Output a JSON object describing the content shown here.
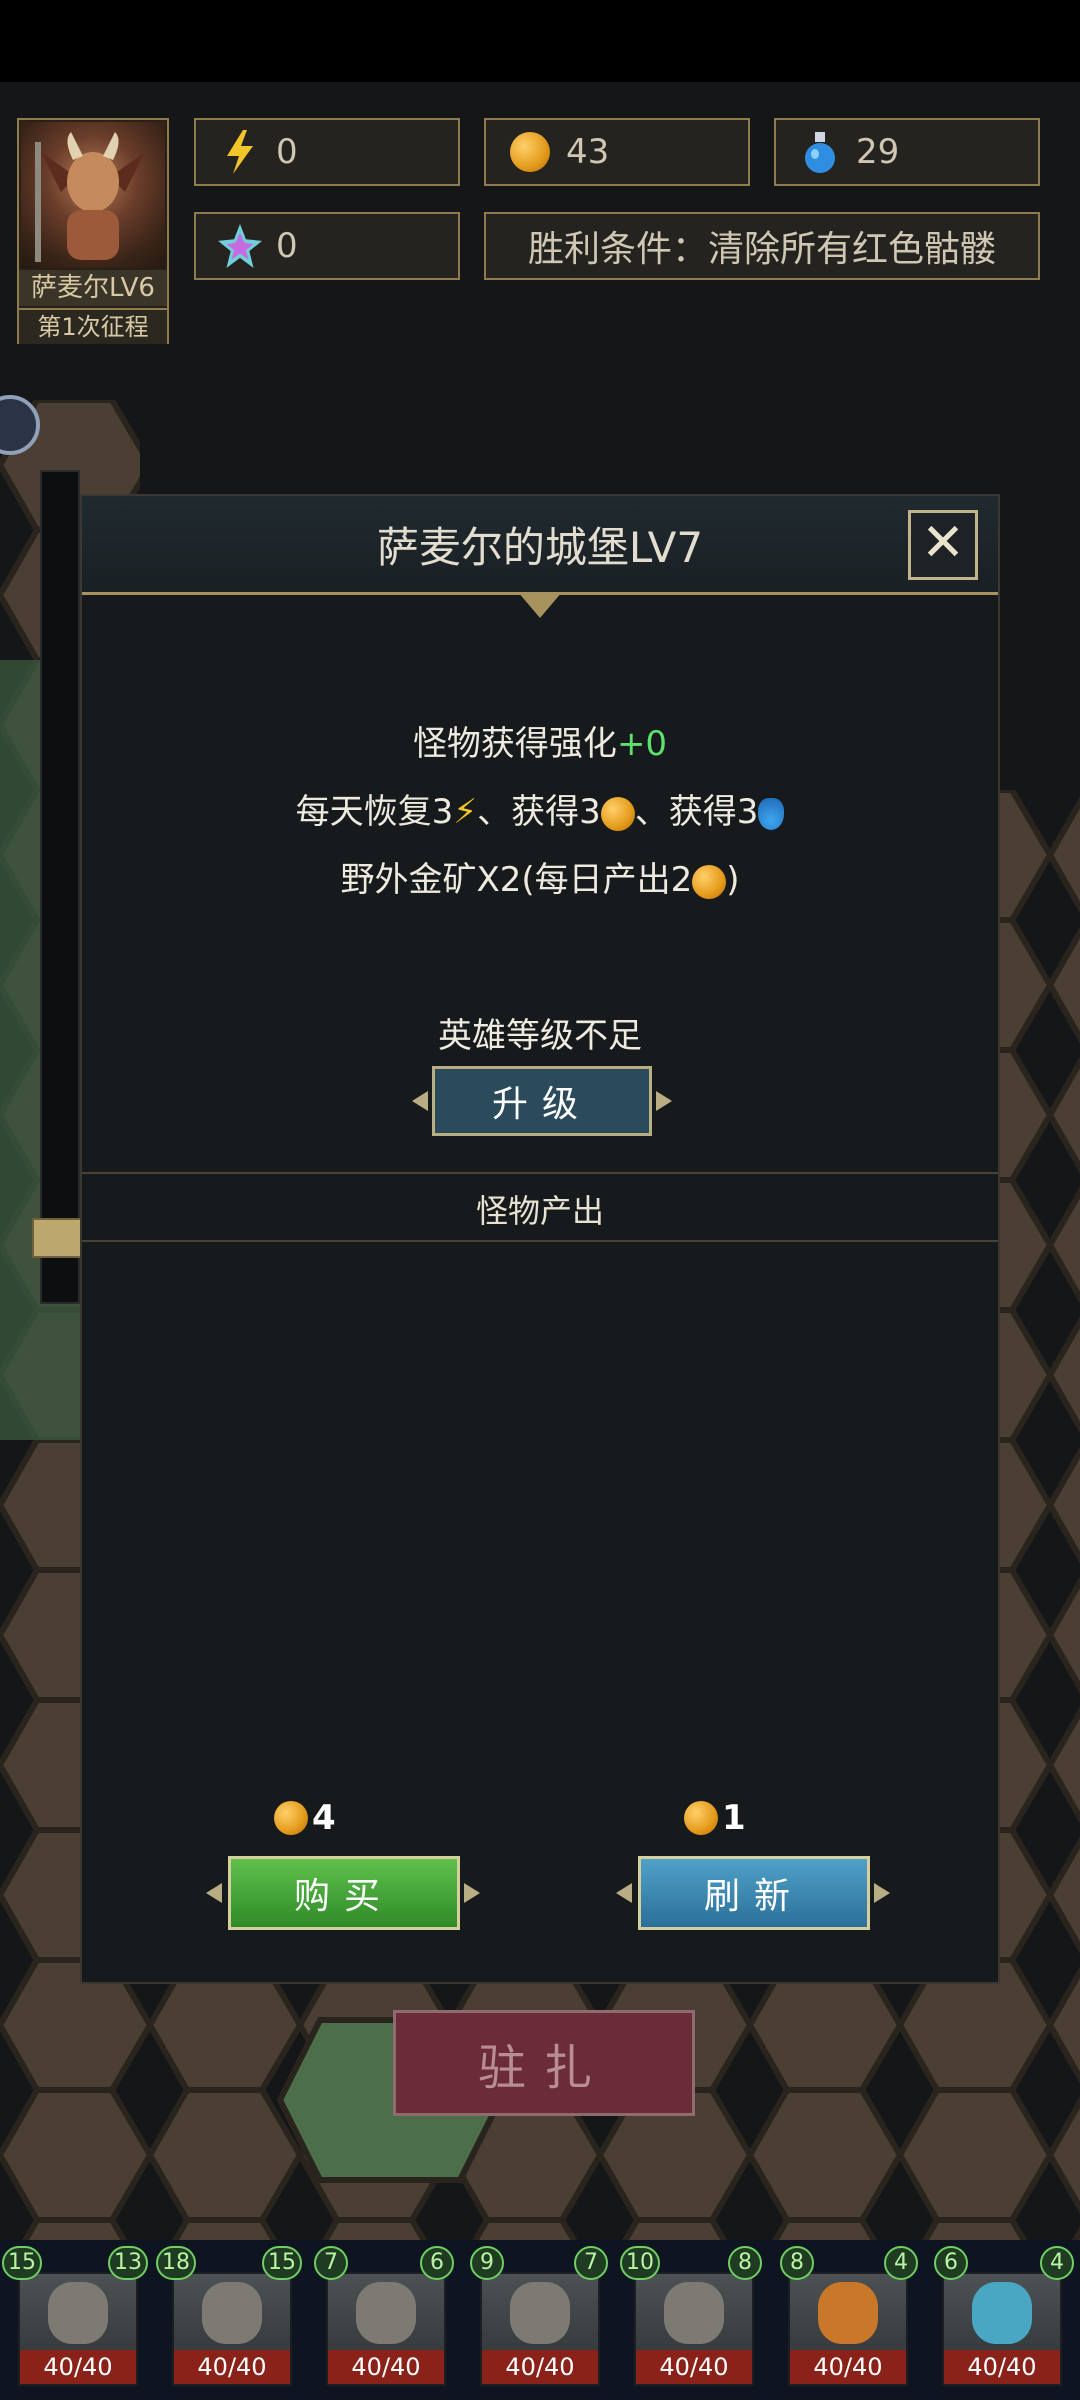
{
  "hero": {
    "name": "萨麦尔LV6",
    "expedition": "第1次征程"
  },
  "resources": {
    "energy": "0",
    "gold": "43",
    "potion": "29",
    "gems": "0"
  },
  "victory_condition": "胜利条件：清除所有红色骷髅",
  "castle": {
    "title": "萨麦尔的城堡LV7",
    "close_label": "✕",
    "buff_prefix": "怪物获得强化",
    "buff_value": "+0",
    "daily_a": "每天恢复3",
    "daily_b": "、获得3",
    "daily_c": "、获得3",
    "mine_a": "野外金矿X2(每日产出2",
    "mine_b": ")",
    "status": "英雄等级不足",
    "upgrade_label": "升级",
    "section_label": "怪物产出",
    "buy_cost": "4",
    "buy_label": "购买",
    "refresh_cost": "1",
    "refresh_label": "刷新"
  },
  "station_label": "驻扎",
  "units": [
    {
      "hp": "40/40",
      "left_level": "15",
      "right_level": "13"
    },
    {
      "hp": "40/40",
      "left_level": "18",
      "right_level": "15"
    },
    {
      "hp": "40/40",
      "left_level": "7",
      "right_level": "6"
    },
    {
      "hp": "40/40",
      "left_level": "9",
      "right_level": "7"
    },
    {
      "hp": "40/40",
      "left_level": "10",
      "right_level": "8"
    },
    {
      "hp": "40/40",
      "left_level": "8",
      "right_level": "4"
    },
    {
      "hp": "40/40",
      "left_level": "6",
      "right_level": "4"
    }
  ],
  "colors": {
    "accent_gold": "#a8935f",
    "buy_green": "#3fa332",
    "refresh_blue": "#3683b0",
    "hp_red": "#8a2219"
  }
}
